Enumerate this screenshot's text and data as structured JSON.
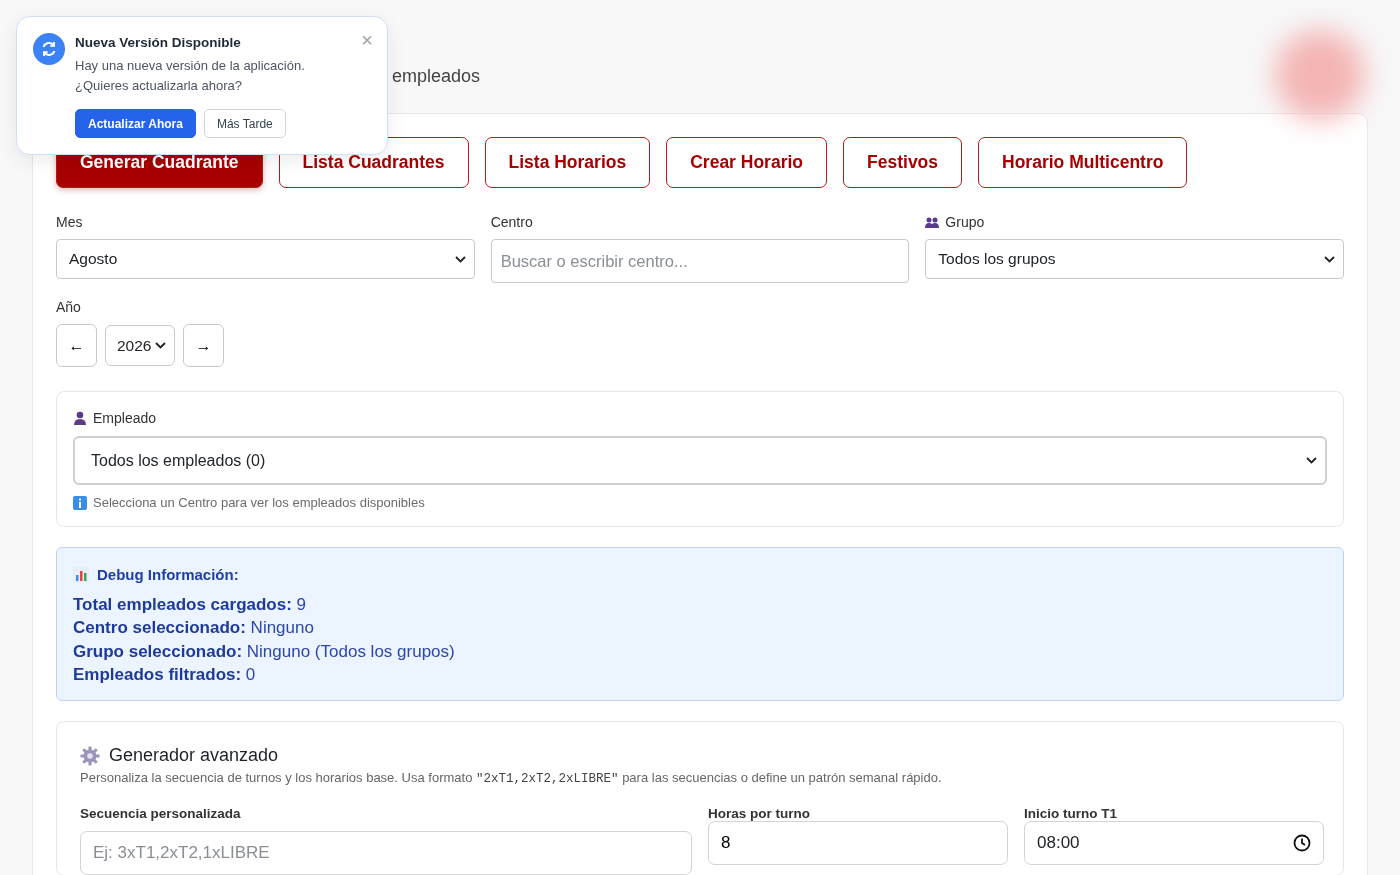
{
  "toast": {
    "title": "Nueva Versión Disponible",
    "lines": [
      "Hay una nueva versión de la aplicación.",
      "¿Quieres actualizarla ahora?"
    ],
    "close": "×",
    "buttons": [
      {
        "label": "Actualizar Ahora",
        "kind": "primary"
      },
      {
        "label": "Más Tarde",
        "kind": "secondary"
      }
    ]
  },
  "header": {
    "subtitle": "empleados"
  },
  "nav_buttons": [
    {
      "label": "Generar Cuadrante",
      "selected": true
    },
    {
      "label": "Lista Cuadrantes",
      "selected": false
    },
    {
      "label": "Lista Horarios",
      "selected": false
    },
    {
      "label": "Crear Horario",
      "selected": false
    },
    {
      "label": "Festivos",
      "selected": false
    },
    {
      "label": "Horario Multicentro",
      "selected": false
    }
  ],
  "filters": [
    {
      "label": "Mes",
      "kind": "select",
      "value": "Agosto"
    },
    {
      "label": "Centro",
      "kind": "search",
      "placeholder": "Buscar o escribir centro..."
    },
    {
      "label": "Grupo",
      "kind": "select",
      "value": "Todos los grupos"
    }
  ],
  "year": {
    "label": "Año",
    "prev": "←",
    "value": "2026",
    "next": "→"
  },
  "employee": {
    "label": "Empleado",
    "value": "Todos los empleados (0)",
    "hint": "Selecciona un Centro para ver los empleados disponibles"
  },
  "debug": {
    "title": "Debug Información:",
    "rows": [
      {
        "label": "Total empleados cargados:",
        "value": "9"
      },
      {
        "label": "Centro seleccionado:",
        "value": "Ninguno"
      },
      {
        "label": "Grupo seleccionado:",
        "value": "Ninguno (Todos los grupos)"
      },
      {
        "label": "Empleados filtrados:",
        "value": "0"
      }
    ]
  },
  "advanced": {
    "title": "Generador avanzado",
    "description_start": "Personaliza la secuencia de turnos y los horarios base. Usa formato ",
    "description_code": "\"2xT1,2xT2,2xLIBRE\"",
    "description_end": " para las secuencias o define un patrón semanal rápido.",
    "fields": [
      {
        "label": "Secuencia personalizada",
        "kind": "text",
        "placeholder": "Ej: 3xT1,2xT2,1xLIBRE"
      },
      {
        "label": "Horas por turno",
        "kind": "number",
        "value": "8"
      },
      {
        "label": "Inicio turno T1",
        "kind": "time",
        "value": "08:00"
      }
    ]
  }
}
